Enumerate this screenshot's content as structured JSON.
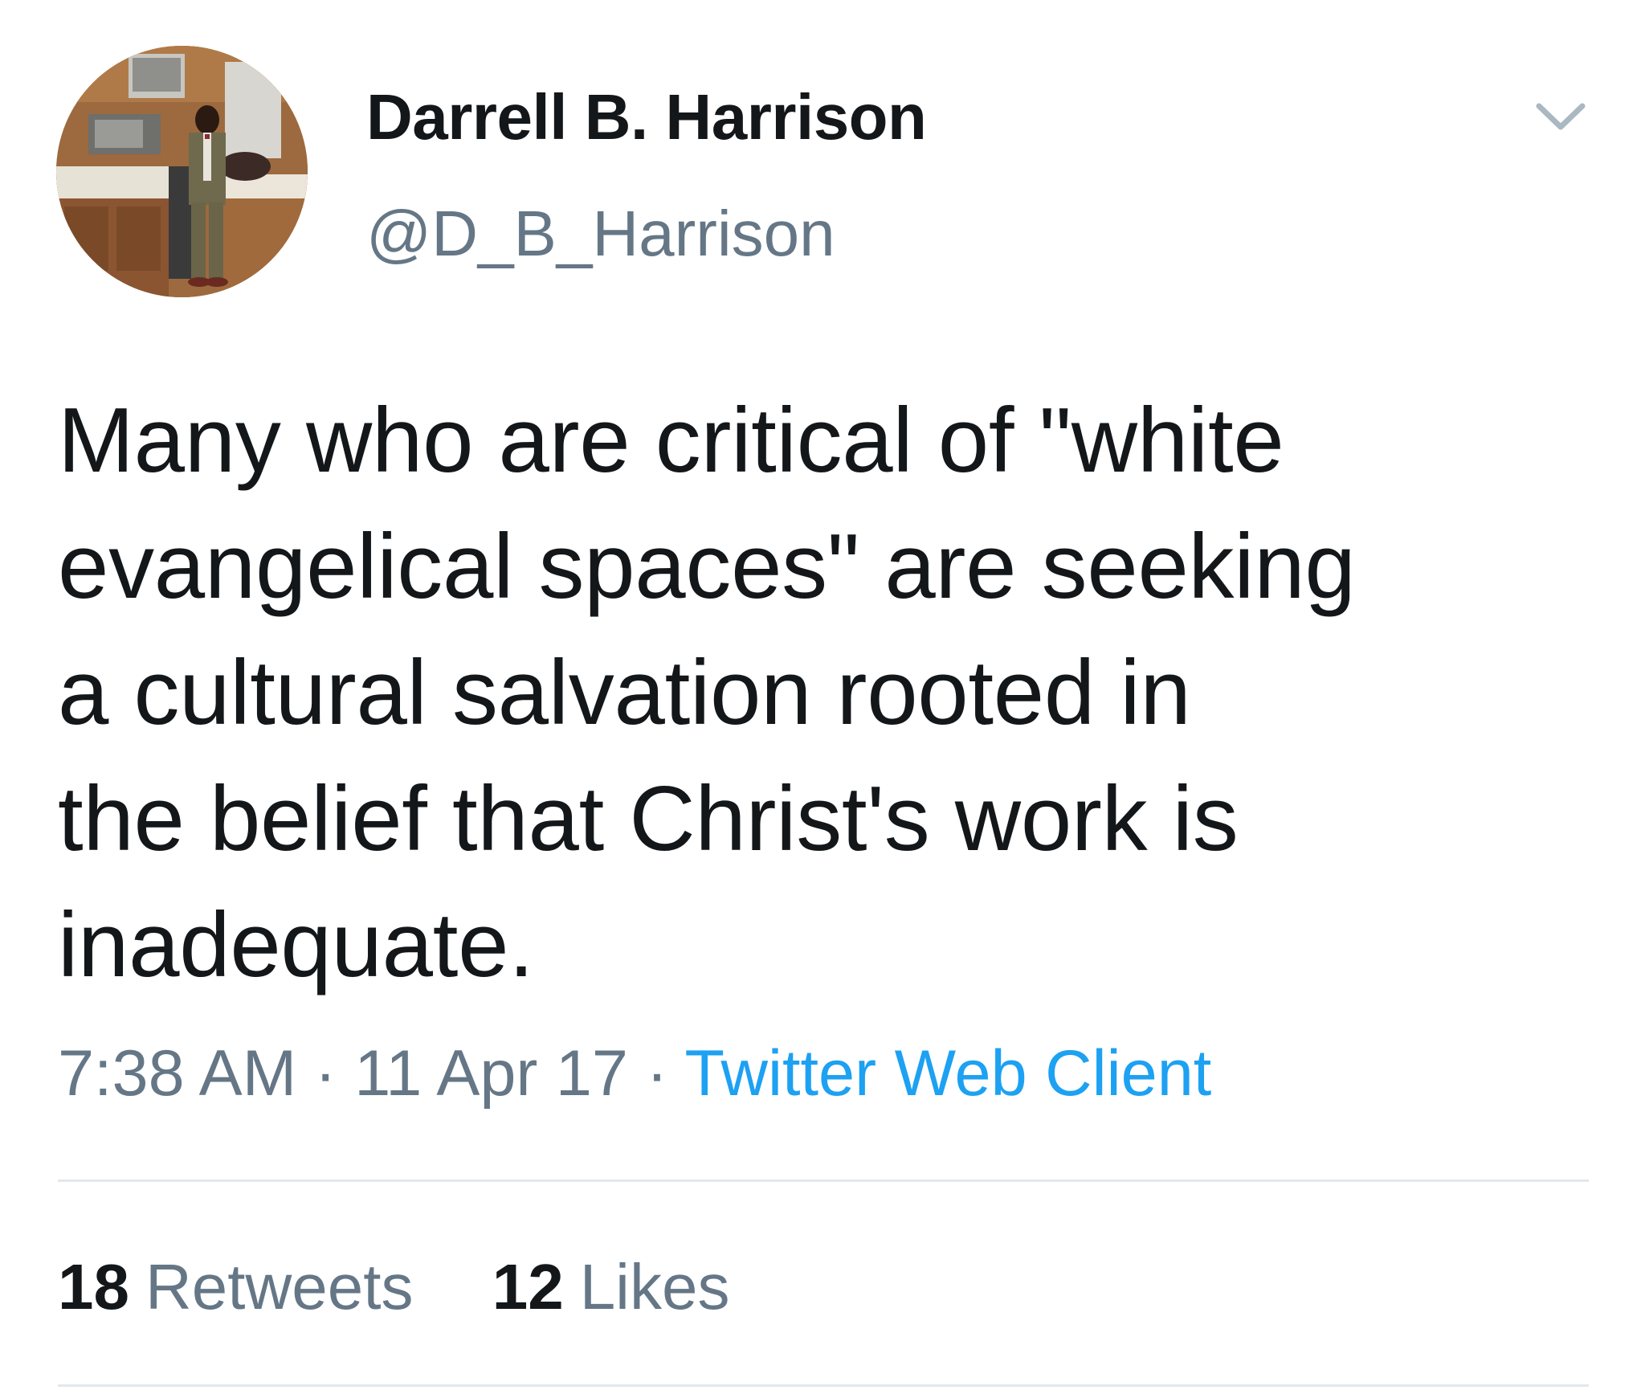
{
  "author": {
    "display_name": "Darrell B. Harrison",
    "handle": "@D_B_Harrison",
    "avatar_icon": "profile-photo"
  },
  "menu": {
    "caret_icon": "chevron-down-icon"
  },
  "tweet": {
    "lines": [
      "Many who are critical of \"white",
      "evangelical spaces\" are seeking",
      "a cultural salvation rooted in",
      "the belief that Christ's work is",
      "inadequate."
    ]
  },
  "meta": {
    "time": "7:38 AM",
    "separator_1": "·",
    "date": "11 Apr 17",
    "separator_2": "·",
    "source": "Twitter Web Client"
  },
  "stats": {
    "retweets_count": "18",
    "retweets_label": "Retweets",
    "likes_count": "12",
    "likes_label": "Likes"
  },
  "colors": {
    "text": "#14171a",
    "secondary": "#657786",
    "link": "#1da1f2",
    "divider": "#e1e8ed"
  }
}
